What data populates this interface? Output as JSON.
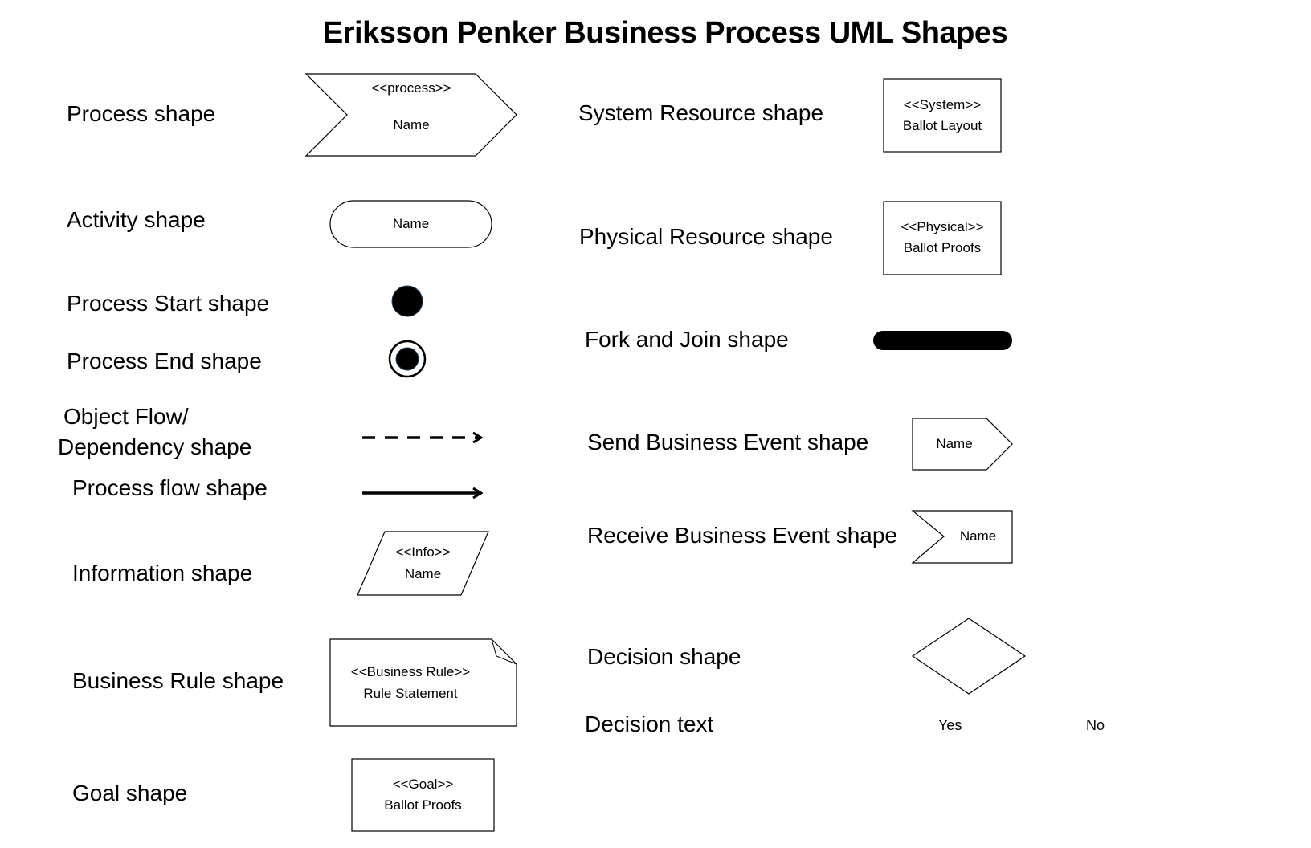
{
  "title": "Eriksson Penker Business Process UML Shapes",
  "left_labels": {
    "process": "Process shape",
    "activity": "Activity shape",
    "process_start": "Process Start shape",
    "process_end": "Process End shape",
    "object_flow_line1": "Object Flow/",
    "object_flow_line2": "Dependency  shape",
    "process_flow": "Process flow shape",
    "information": "Information shape",
    "business_rule": "Business Rule shape",
    "goal": "Goal shape"
  },
  "right_labels": {
    "system_resource": "System Resource shape",
    "physical_resource": "Physical Resource shape",
    "fork_join": "Fork and Join shape",
    "send_event": "Send Business Event shape",
    "receive_event": "Receive Business Event shape",
    "decision": "Decision shape",
    "decision_text": "Decision text"
  },
  "shapes": {
    "process": {
      "stereotype": "<<process>>",
      "name": "Name"
    },
    "activity": {
      "name": "Name"
    },
    "information": {
      "stereotype": "<<Info>>",
      "name": "Name"
    },
    "business_rule": {
      "stereotype": "<<Business  Rule>>",
      "name": "Rule Statement"
    },
    "goal": {
      "stereotype": "<<Goal>>",
      "name": "Ballot Proofs"
    },
    "system_resource": {
      "stereotype": "<<System>>",
      "name": "Ballot Layout"
    },
    "physical_resource": {
      "stereotype": "<<Physical>>",
      "name": "Ballot Proofs"
    },
    "send_event": {
      "name": "Name"
    },
    "receive_event": {
      "name": "Name"
    },
    "decision_text": {
      "yes": "Yes",
      "no": "No"
    }
  },
  "colors": {
    "stroke": "#000000",
    "background": "#ffffff"
  }
}
